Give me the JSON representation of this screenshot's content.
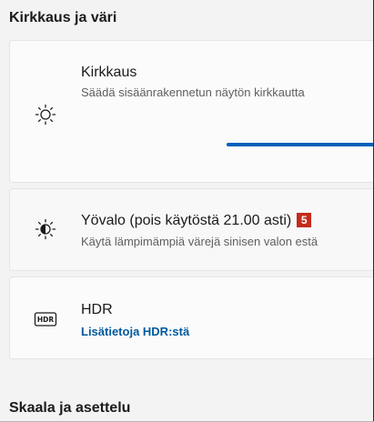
{
  "sections": {
    "brightness_color": "Kirkkaus ja väri",
    "scale_layout": "Skaala ja asettelu"
  },
  "brightness": {
    "title": "Kirkkaus",
    "description": "Säädä sisäänrakennetun näytön kirkkautta",
    "icon": "sun-icon",
    "slider_value_fraction": 1.0
  },
  "night_light": {
    "title": "Yövalo (pois käytöstä 21.00 asti)",
    "badge": "5",
    "description": "Käytä lämpimämpiä värejä sinisen valon estä",
    "icon": "night-light-icon"
  },
  "hdr": {
    "title": "HDR",
    "link": "Lisätietoja HDR:stä",
    "icon": "hdr-icon"
  },
  "colors": {
    "accent": "#005fb8",
    "link": "#005a9e",
    "badge": "#c42b1c"
  }
}
